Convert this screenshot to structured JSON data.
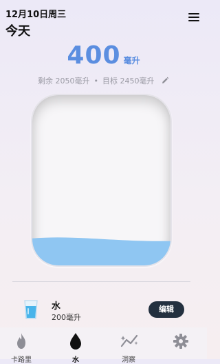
{
  "header": {
    "date": "12月10日周三",
    "title": "今天"
  },
  "intake": {
    "value": "400",
    "unit": "毫升",
    "remaining": "剩余 2050毫升",
    "separator": "•",
    "target": "目标 2450毫升",
    "fill_fraction": 0.163
  },
  "colors": {
    "accent": "#5b8ee0",
    "water": "#8fc6f2",
    "button": "#23303f"
  },
  "drink": {
    "name": "水",
    "amount": "200毫升",
    "edit_label": "编辑",
    "icon": "water-glass-icon"
  },
  "nav": {
    "items": [
      {
        "label": "卡路里",
        "icon": "flame-icon"
      },
      {
        "label": "水",
        "icon": "water-drop-icon",
        "active": true
      },
      {
        "label": "洞察",
        "icon": "insights-icon"
      },
      {
        "label": "",
        "icon": "gear-icon"
      }
    ]
  }
}
